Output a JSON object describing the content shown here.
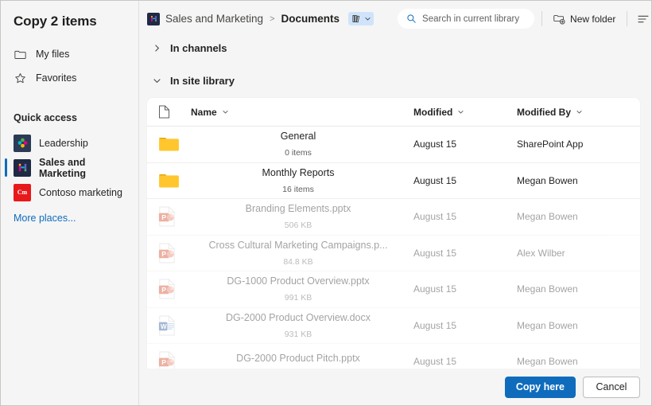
{
  "dialog": {
    "title": "Copy 2 items"
  },
  "sidebar": {
    "nav": [
      {
        "label": "My files",
        "icon": "folder-icon"
      },
      {
        "label": "Favorites",
        "icon": "star-icon"
      }
    ],
    "quick_access_label": "Quick access",
    "quick_access": [
      {
        "label": "Leadership",
        "icon": "leadership-site-icon",
        "selected": false
      },
      {
        "label": "Sales and Marketing",
        "icon": "sales-marketing-site-icon",
        "selected": true
      },
      {
        "label": "Contoso marketing",
        "icon": "contoso-marketing-site-icon",
        "badge": "Cm",
        "selected": false
      }
    ],
    "more_places": "More places..."
  },
  "topbar": {
    "breadcrumb": {
      "site": "Sales and Marketing",
      "separator": ">",
      "current": "Documents"
    },
    "library_chip_icon": "library-icon",
    "search": {
      "placeholder": "Search in current library",
      "value": "",
      "icon": "search-icon"
    },
    "new_folder_label": "New folder",
    "new_folder_icon": "new-folder-icon",
    "view_icon": "view-options-icon"
  },
  "sections": [
    {
      "label": "In channels",
      "expanded": false
    },
    {
      "label": "In site library",
      "expanded": true
    }
  ],
  "list": {
    "columns": {
      "icon": "file-type-icon",
      "name": "Name",
      "modified": "Modified",
      "modified_by": "Modified By"
    },
    "rows": [
      {
        "name": "General",
        "sub": "0 items",
        "modified": "August 15",
        "modified_by": "SharePoint App",
        "icon": "folder-icon",
        "dim": false
      },
      {
        "name": "Monthly Reports",
        "sub": "16 items",
        "modified": "August 15",
        "modified_by": "Megan Bowen",
        "icon": "folder-icon",
        "dim": false
      },
      {
        "name": "Branding Elements.pptx",
        "sub": "506 KB",
        "modified": "August 15",
        "modified_by": "Megan Bowen",
        "icon": "powerpoint-icon",
        "dim": true
      },
      {
        "name": "Cross Cultural Marketing Campaigns.p...",
        "sub": "84.8 KB",
        "modified": "August 15",
        "modified_by": "Alex Wilber",
        "icon": "powerpoint-icon",
        "dim": true
      },
      {
        "name": "DG-1000 Product Overview.pptx",
        "sub": "991 KB",
        "modified": "August 15",
        "modified_by": "Megan Bowen",
        "icon": "powerpoint-icon",
        "dim": true
      },
      {
        "name": "DG-2000 Product Overview.docx",
        "sub": "931 KB",
        "modified": "August 15",
        "modified_by": "Megan Bowen",
        "icon": "word-icon",
        "dim": true
      },
      {
        "name": "DG-2000 Product Pitch.pptx",
        "sub": "",
        "modified": "August 15",
        "modified_by": "Megan Bowen",
        "icon": "powerpoint-icon",
        "dim": true
      }
    ]
  },
  "footer": {
    "primary_label": "Copy here",
    "secondary_label": "Cancel"
  },
  "colors": {
    "accent": "#0f6cbd",
    "folder": "#ffc62e",
    "powerpoint": "#d24726",
    "word": "#2b579a",
    "background": "#f5f5f5",
    "card": "#ffffff"
  }
}
